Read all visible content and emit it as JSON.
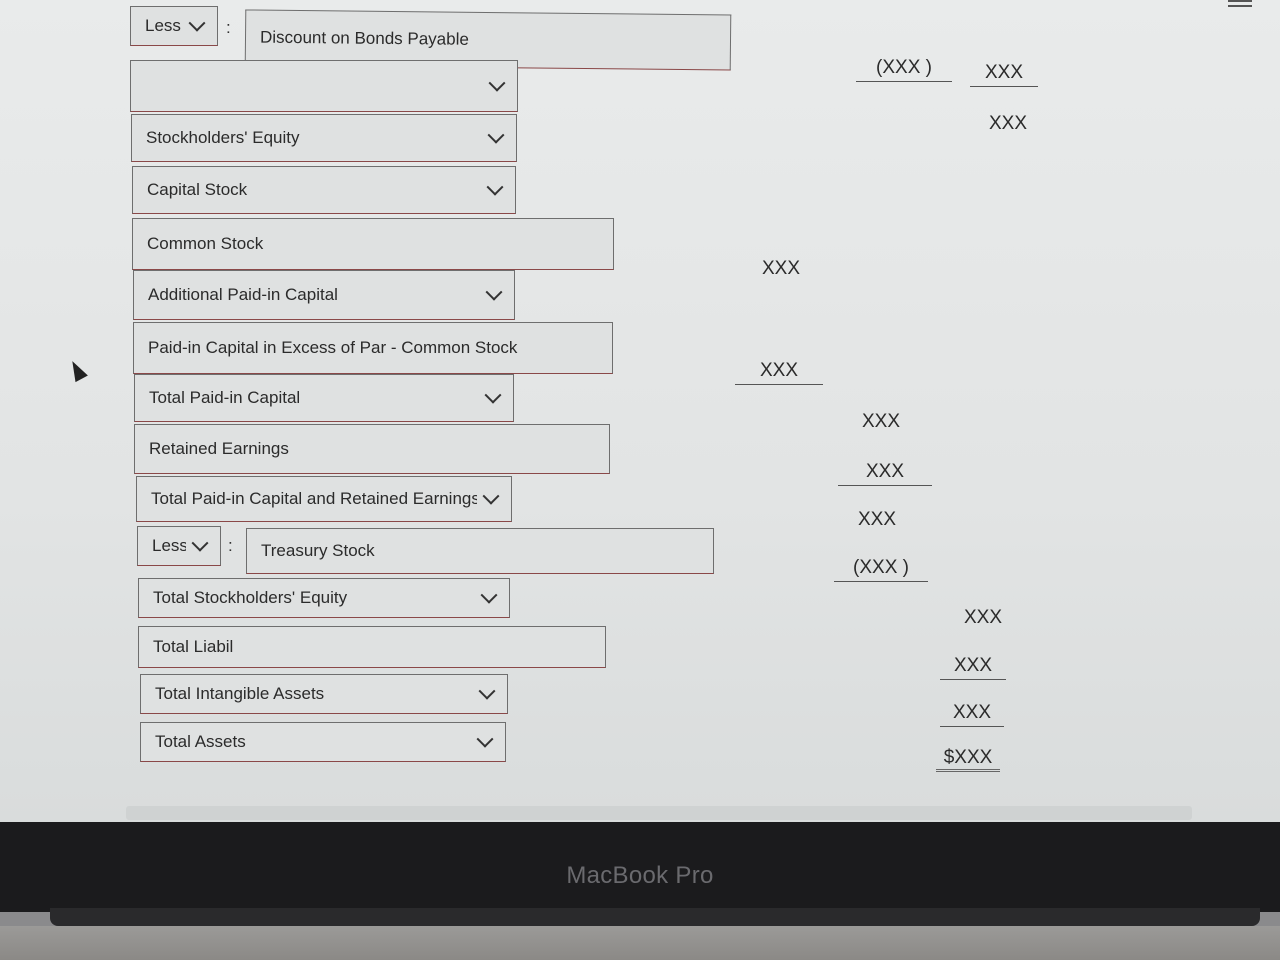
{
  "form": {
    "rows": [
      {
        "id": "less-select-1",
        "kind": "select",
        "value": "Less"
      },
      {
        "id": "discount-bonds",
        "kind": "input",
        "value": "Discount on Bonds Payable"
      },
      {
        "id": "blank-select",
        "kind": "select",
        "value": ""
      },
      {
        "id": "stockholders-equity",
        "kind": "select",
        "value": "Stockholders' Equity"
      },
      {
        "id": "capital-stock",
        "kind": "select",
        "value": "Capital Stock"
      },
      {
        "id": "common-stock",
        "kind": "input",
        "value": "Common Stock"
      },
      {
        "id": "additional-paid-in",
        "kind": "select",
        "value": "Additional Paid-in Capital"
      },
      {
        "id": "paid-in-excess",
        "kind": "input",
        "value": "Paid-in Capital in Excess of Par - Common Stock"
      },
      {
        "id": "total-paid-in",
        "kind": "select",
        "value": "Total Paid-in Capital"
      },
      {
        "id": "retained-earnings",
        "kind": "input",
        "value": "Retained Earnings"
      },
      {
        "id": "total-paid-in-retained",
        "kind": "select",
        "value": "Total Paid-in Capital and Retained Earnings"
      },
      {
        "id": "less-select-2",
        "kind": "select",
        "value": "Less"
      },
      {
        "id": "treasury-stock",
        "kind": "input",
        "value": "Treasury Stock"
      },
      {
        "id": "total-stockholders-equity",
        "kind": "select",
        "value": "Total Stockholders' Equity"
      },
      {
        "id": "total-liabil",
        "kind": "input",
        "value": "Total Liabil"
      },
      {
        "id": "total-intangible",
        "kind": "select",
        "value": "Total Intangible Assets"
      },
      {
        "id": "total-assets",
        "kind": "select",
        "value": "Total Assets"
      }
    ],
    "colon": ":"
  },
  "amounts": {
    "a1": "(XXX  )",
    "a2": "XXX",
    "a3": "XXX",
    "a4": "XXX",
    "a5": "XXX",
    "a6": "XXX",
    "a7": "XXX",
    "a8": "XXX",
    "a9": "(XXX  )",
    "a10": "XXX",
    "a11": "XXX",
    "a12": "XXX",
    "a13": "$XXX"
  },
  "device": {
    "brand": "MacBook Pro"
  }
}
